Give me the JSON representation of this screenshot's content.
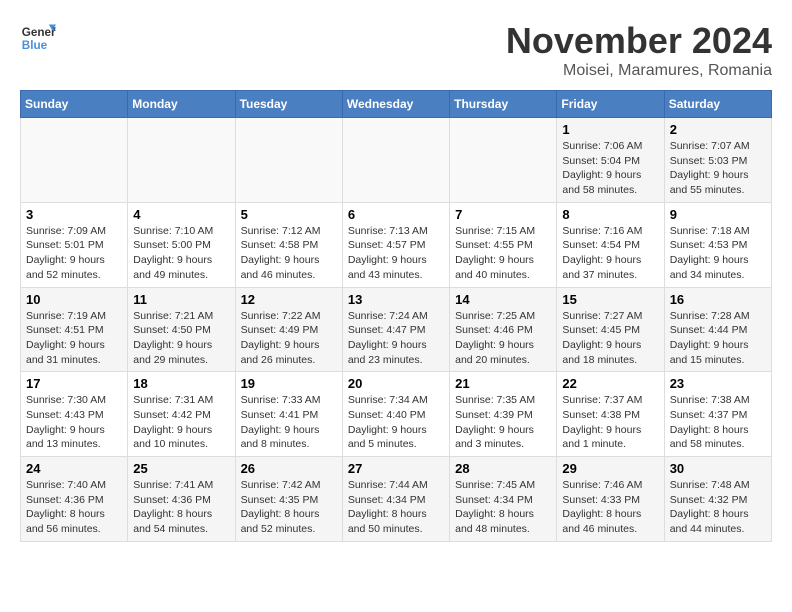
{
  "logo": {
    "general": "General",
    "blue": "Blue"
  },
  "title": "November 2024",
  "location": "Moisei, Maramures, Romania",
  "days_of_week": [
    "Sunday",
    "Monday",
    "Tuesday",
    "Wednesday",
    "Thursday",
    "Friday",
    "Saturday"
  ],
  "weeks": [
    [
      {
        "day": "",
        "info": ""
      },
      {
        "day": "",
        "info": ""
      },
      {
        "day": "",
        "info": ""
      },
      {
        "day": "",
        "info": ""
      },
      {
        "day": "",
        "info": ""
      },
      {
        "day": "1",
        "info": "Sunrise: 7:06 AM\nSunset: 5:04 PM\nDaylight: 9 hours and 58 minutes."
      },
      {
        "day": "2",
        "info": "Sunrise: 7:07 AM\nSunset: 5:03 PM\nDaylight: 9 hours and 55 minutes."
      }
    ],
    [
      {
        "day": "3",
        "info": "Sunrise: 7:09 AM\nSunset: 5:01 PM\nDaylight: 9 hours and 52 minutes."
      },
      {
        "day": "4",
        "info": "Sunrise: 7:10 AM\nSunset: 5:00 PM\nDaylight: 9 hours and 49 minutes."
      },
      {
        "day": "5",
        "info": "Sunrise: 7:12 AM\nSunset: 4:58 PM\nDaylight: 9 hours and 46 minutes."
      },
      {
        "day": "6",
        "info": "Sunrise: 7:13 AM\nSunset: 4:57 PM\nDaylight: 9 hours and 43 minutes."
      },
      {
        "day": "7",
        "info": "Sunrise: 7:15 AM\nSunset: 4:55 PM\nDaylight: 9 hours and 40 minutes."
      },
      {
        "day": "8",
        "info": "Sunrise: 7:16 AM\nSunset: 4:54 PM\nDaylight: 9 hours and 37 minutes."
      },
      {
        "day": "9",
        "info": "Sunrise: 7:18 AM\nSunset: 4:53 PM\nDaylight: 9 hours and 34 minutes."
      }
    ],
    [
      {
        "day": "10",
        "info": "Sunrise: 7:19 AM\nSunset: 4:51 PM\nDaylight: 9 hours and 31 minutes."
      },
      {
        "day": "11",
        "info": "Sunrise: 7:21 AM\nSunset: 4:50 PM\nDaylight: 9 hours and 29 minutes."
      },
      {
        "day": "12",
        "info": "Sunrise: 7:22 AM\nSunset: 4:49 PM\nDaylight: 9 hours and 26 minutes."
      },
      {
        "day": "13",
        "info": "Sunrise: 7:24 AM\nSunset: 4:47 PM\nDaylight: 9 hours and 23 minutes."
      },
      {
        "day": "14",
        "info": "Sunrise: 7:25 AM\nSunset: 4:46 PM\nDaylight: 9 hours and 20 minutes."
      },
      {
        "day": "15",
        "info": "Sunrise: 7:27 AM\nSunset: 4:45 PM\nDaylight: 9 hours and 18 minutes."
      },
      {
        "day": "16",
        "info": "Sunrise: 7:28 AM\nSunset: 4:44 PM\nDaylight: 9 hours and 15 minutes."
      }
    ],
    [
      {
        "day": "17",
        "info": "Sunrise: 7:30 AM\nSunset: 4:43 PM\nDaylight: 9 hours and 13 minutes."
      },
      {
        "day": "18",
        "info": "Sunrise: 7:31 AM\nSunset: 4:42 PM\nDaylight: 9 hours and 10 minutes."
      },
      {
        "day": "19",
        "info": "Sunrise: 7:33 AM\nSunset: 4:41 PM\nDaylight: 9 hours and 8 minutes."
      },
      {
        "day": "20",
        "info": "Sunrise: 7:34 AM\nSunset: 4:40 PM\nDaylight: 9 hours and 5 minutes."
      },
      {
        "day": "21",
        "info": "Sunrise: 7:35 AM\nSunset: 4:39 PM\nDaylight: 9 hours and 3 minutes."
      },
      {
        "day": "22",
        "info": "Sunrise: 7:37 AM\nSunset: 4:38 PM\nDaylight: 9 hours and 1 minute."
      },
      {
        "day": "23",
        "info": "Sunrise: 7:38 AM\nSunset: 4:37 PM\nDaylight: 8 hours and 58 minutes."
      }
    ],
    [
      {
        "day": "24",
        "info": "Sunrise: 7:40 AM\nSunset: 4:36 PM\nDaylight: 8 hours and 56 minutes."
      },
      {
        "day": "25",
        "info": "Sunrise: 7:41 AM\nSunset: 4:36 PM\nDaylight: 8 hours and 54 minutes."
      },
      {
        "day": "26",
        "info": "Sunrise: 7:42 AM\nSunset: 4:35 PM\nDaylight: 8 hours and 52 minutes."
      },
      {
        "day": "27",
        "info": "Sunrise: 7:44 AM\nSunset: 4:34 PM\nDaylight: 8 hours and 50 minutes."
      },
      {
        "day": "28",
        "info": "Sunrise: 7:45 AM\nSunset: 4:34 PM\nDaylight: 8 hours and 48 minutes."
      },
      {
        "day": "29",
        "info": "Sunrise: 7:46 AM\nSunset: 4:33 PM\nDaylight: 8 hours and 46 minutes."
      },
      {
        "day": "30",
        "info": "Sunrise: 7:48 AM\nSunset: 4:32 PM\nDaylight: 8 hours and 44 minutes."
      }
    ]
  ]
}
